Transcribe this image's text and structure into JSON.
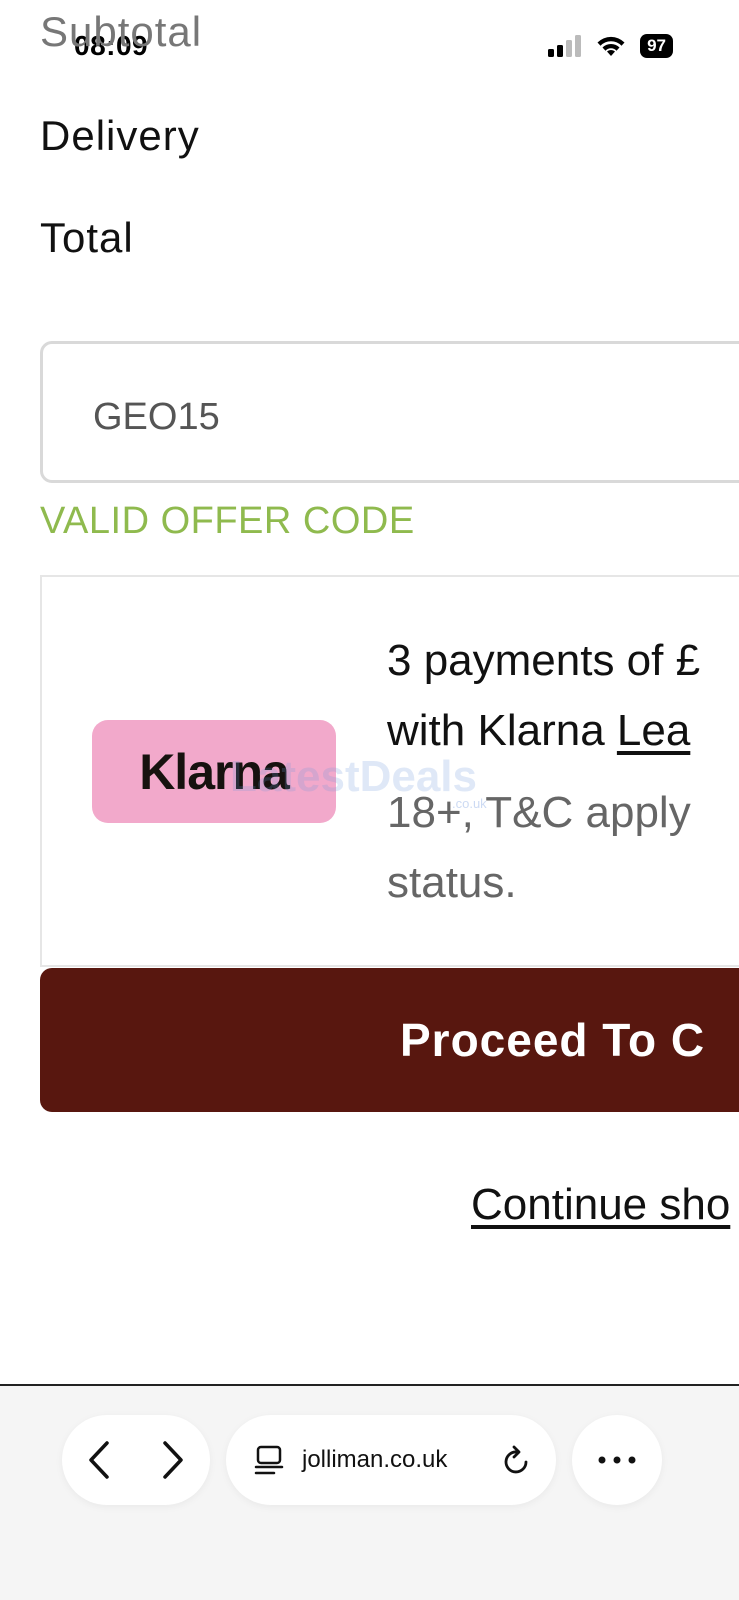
{
  "status_bar": {
    "time": "08:09",
    "battery": "97"
  },
  "summary": {
    "subtotal_label": "Subtotal",
    "delivery_label": "Delivery",
    "total_label": "Total"
  },
  "offer": {
    "code_value": "GEO15",
    "valid_message": "VALID OFFER CODE"
  },
  "klarna": {
    "logo_text": "Klarna",
    "line1": "3 payments of £",
    "line2_prefix": "with Klarna ",
    "learn_link": "Lea",
    "line3": "18+, T&C apply",
    "line4": "status."
  },
  "watermark": {
    "main": "LatestDeals",
    "sub": ".co.uk"
  },
  "actions": {
    "proceed_label": "Proceed To C",
    "continue_label": "Continue sho"
  },
  "browser": {
    "url": "jolliman.co.uk"
  },
  "colors": {
    "proceed_bg": "#58170f",
    "valid_green": "#8fba4e",
    "klarna_pink": "#f2a9cb"
  }
}
